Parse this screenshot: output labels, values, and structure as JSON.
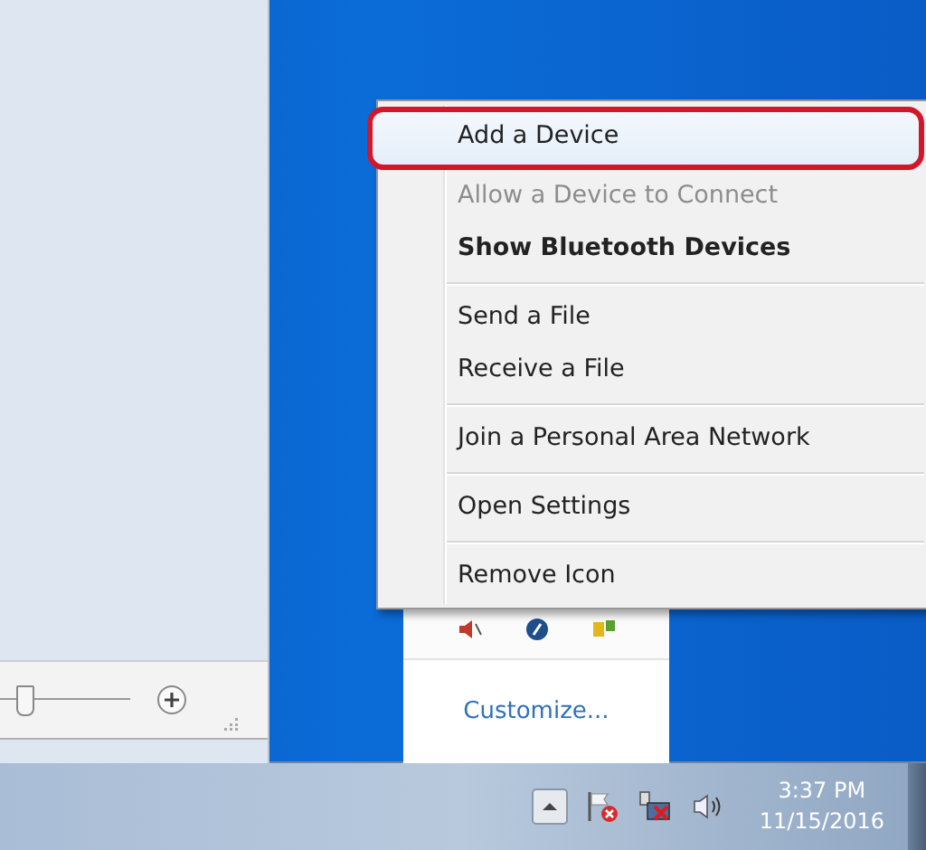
{
  "context_menu": {
    "groups": [
      [
        {
          "label": "Add a Device",
          "selected": true,
          "disabled": false,
          "default": false
        },
        {
          "label": "Allow a Device to Connect",
          "selected": false,
          "disabled": true,
          "default": false
        },
        {
          "label": "Show Bluetooth Devices",
          "selected": false,
          "disabled": false,
          "default": true
        }
      ],
      [
        {
          "label": "Send a File",
          "selected": false,
          "disabled": false,
          "default": false
        },
        {
          "label": "Receive a File",
          "selected": false,
          "disabled": false,
          "default": false
        }
      ],
      [
        {
          "label": "Join a Personal Area Network",
          "selected": false,
          "disabled": false,
          "default": false
        }
      ],
      [
        {
          "label": "Open Settings",
          "selected": false,
          "disabled": false,
          "default": false
        }
      ],
      [
        {
          "label": "Remove Icon",
          "selected": false,
          "disabled": false,
          "default": false
        }
      ]
    ]
  },
  "zoom_slider": {
    "level": 0.2
  },
  "tray_overflow": {
    "link": "Customize..."
  },
  "clock": {
    "time": "3:37 PM",
    "date": "11/15/2016"
  }
}
